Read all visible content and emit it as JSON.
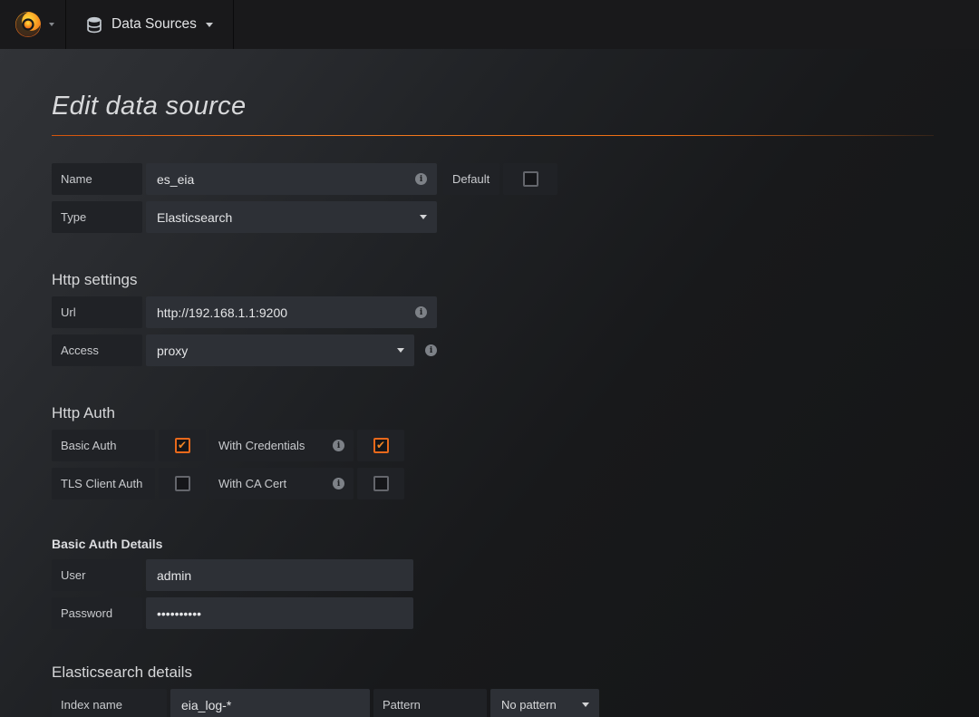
{
  "navbar": {
    "datasources_label": "Data Sources"
  },
  "icons": {
    "logo": "grafana-logo",
    "nav_item": "database-icon",
    "dropdowns": "caret-down-icon",
    "field_hint": "info-circle-icon",
    "checkbox_checked_glyph": "checkmark"
  },
  "colors": {
    "accent_orange": "#ee6d13",
    "label_bg": "#202226",
    "input_bg": "#2d3036",
    "navbar_bg": "#19191b"
  },
  "page": {
    "title": "Edit data source"
  },
  "form": {
    "name": {
      "label": "Name",
      "value": "es_eia"
    },
    "default": {
      "label": "Default",
      "checked": false
    },
    "type": {
      "label": "Type",
      "value": "Elasticsearch"
    },
    "http_settings": {
      "heading": "Http settings",
      "url": {
        "label": "Url",
        "value": "http://192.168.1.1:9200"
      },
      "access": {
        "label": "Access",
        "value": "proxy"
      }
    },
    "http_auth": {
      "heading": "Http Auth",
      "basic_auth": {
        "label": "Basic Auth",
        "checked": true
      },
      "with_credentials": {
        "label": "With Credentials",
        "checked": true
      },
      "tls_client_auth": {
        "label": "TLS Client Auth",
        "checked": false
      },
      "with_ca_cert": {
        "label": "With CA Cert",
        "checked": false
      }
    },
    "basic_auth_details": {
      "heading": "Basic Auth Details",
      "user": {
        "label": "User",
        "value": "admin"
      },
      "password": {
        "label": "Password",
        "value": "••••••••••"
      }
    },
    "elasticsearch_details": {
      "heading": "Elasticsearch details",
      "index_name": {
        "label": "Index name",
        "value": "eia_log-*"
      },
      "pattern": {
        "label": "Pattern",
        "value": "No pattern"
      }
    }
  }
}
